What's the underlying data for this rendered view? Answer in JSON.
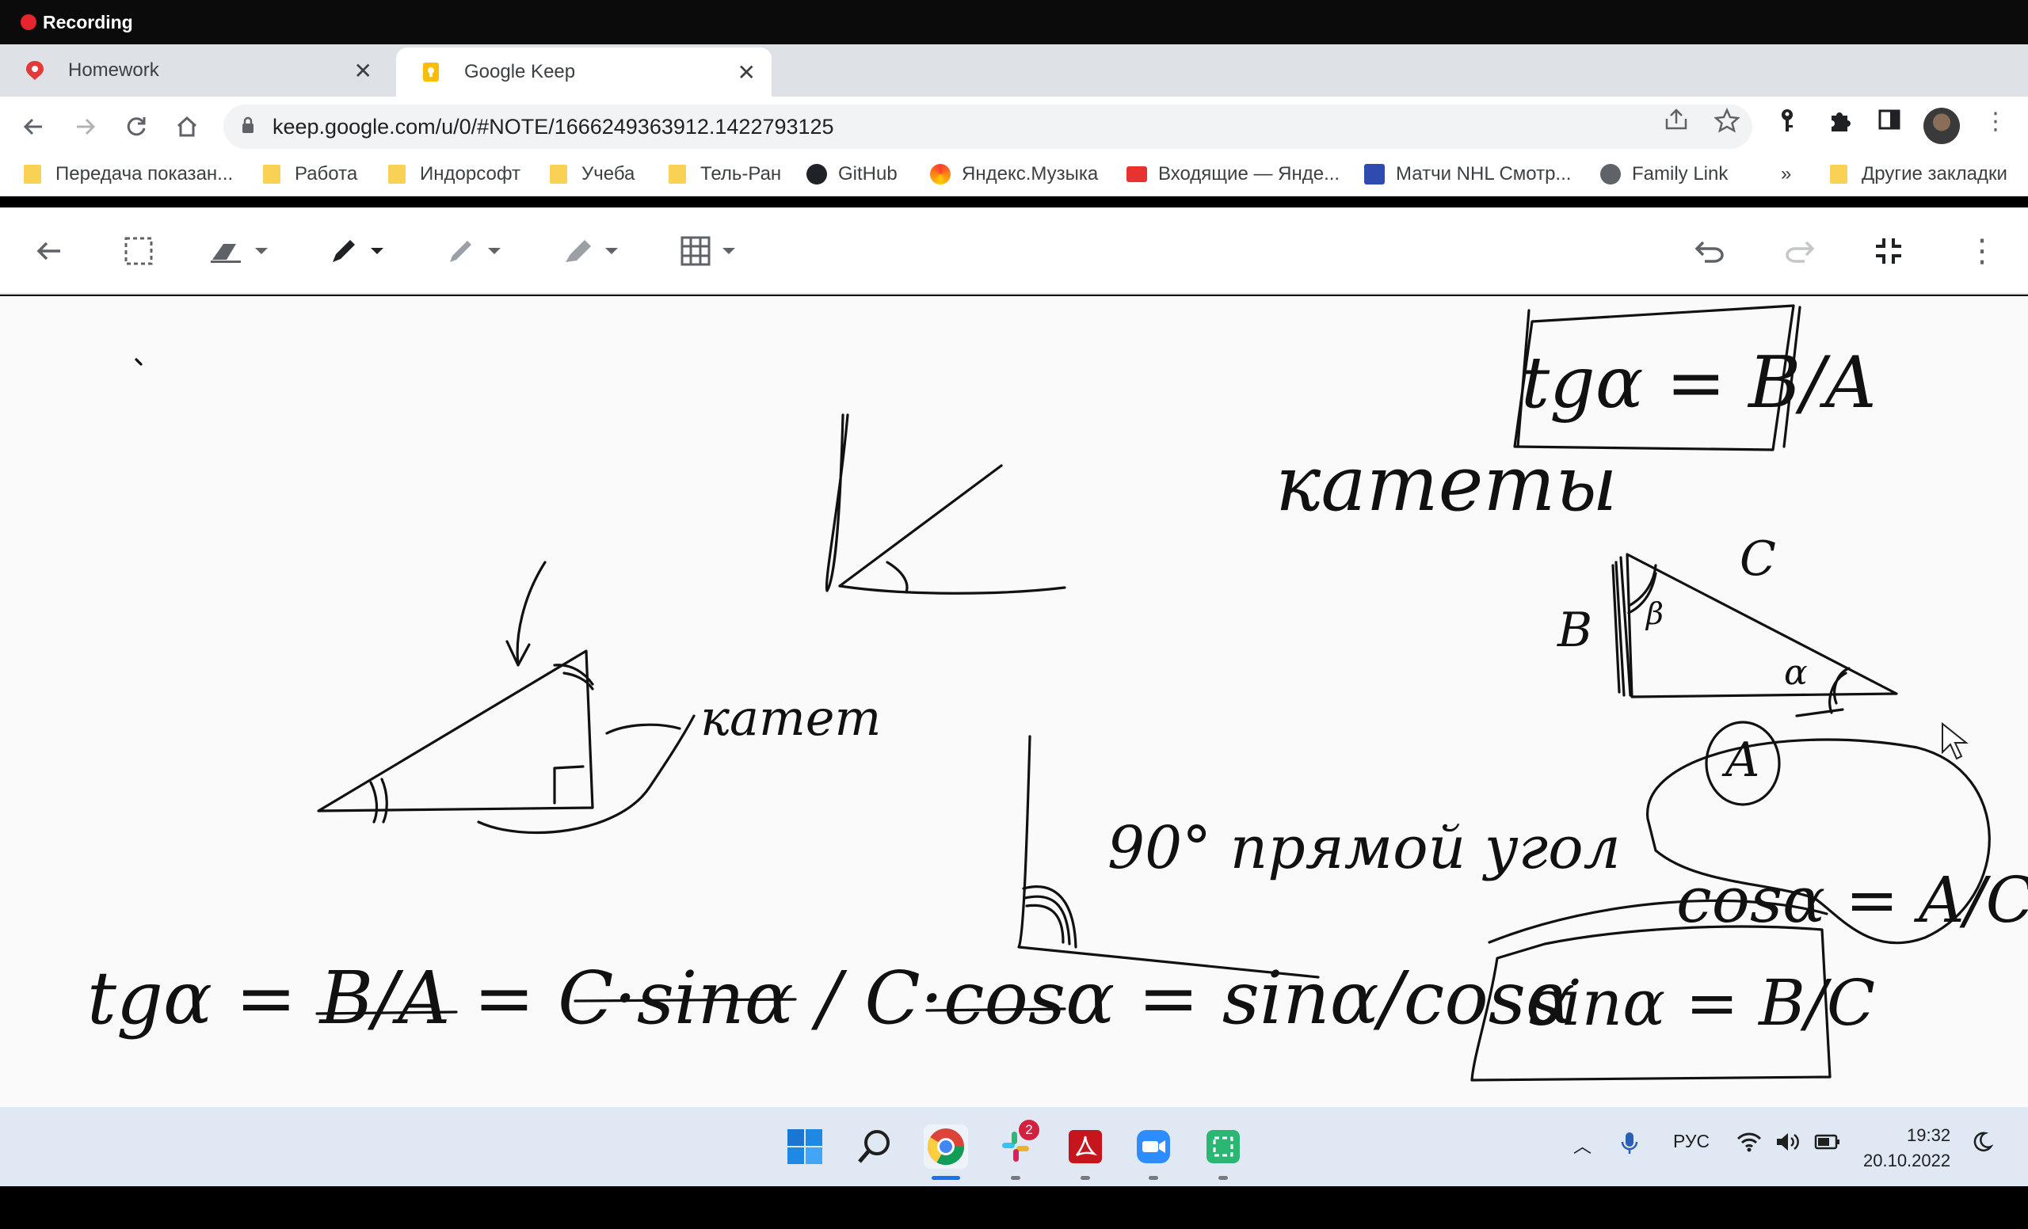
{
  "recording": {
    "label": "Recording"
  },
  "tabs": [
    {
      "title": "Homework",
      "icon": "homework-icon",
      "active": false
    },
    {
      "title": "Google Keep",
      "icon": "keep-icon",
      "active": true
    }
  ],
  "address_bar": {
    "url": "keep.google.com/u/0/#NOTE/1666249363912.1422793125"
  },
  "bookmarks": [
    {
      "label": "Передача показан...",
      "icon": "folder-icon"
    },
    {
      "label": "Работа",
      "icon": "folder-icon"
    },
    {
      "label": "Индорсофт",
      "icon": "folder-icon"
    },
    {
      "label": "Учеба",
      "icon": "folder-icon"
    },
    {
      "label": "Тель-Ран",
      "icon": "folder-icon"
    },
    {
      "label": "GitHub",
      "icon": "github-icon"
    },
    {
      "label": "Яндекс.Музыка",
      "icon": "yandex-music-icon"
    },
    {
      "label": "Входящие — Янде...",
      "icon": "mail-icon"
    },
    {
      "label": "Матчи NHL Смотр...",
      "icon": "nhl-icon"
    },
    {
      "label": "Family Link",
      "icon": "family-link-icon"
    }
  ],
  "bookmarks_more": "»",
  "bookmarks_other": "Другие закладки",
  "canvas_text": {
    "katety": "катеты",
    "katet": "катет",
    "right_angle": "90° прямой угол",
    "tg_box": "tgα = B/A",
    "cos_eq": "cosα = A/C",
    "sin_eq": "sinα = B/C",
    "label_B": "B",
    "label_C": "C",
    "label_A": "A",
    "label_alpha": "α",
    "label_beta": "β",
    "bottom_eq": "tgα = B/A = C·sinα / C·cosα = sinα/cosα"
  },
  "taskbar": {
    "language": "РУС",
    "time": "19:32",
    "date": "20.10.2022",
    "slack_badge": "2"
  }
}
